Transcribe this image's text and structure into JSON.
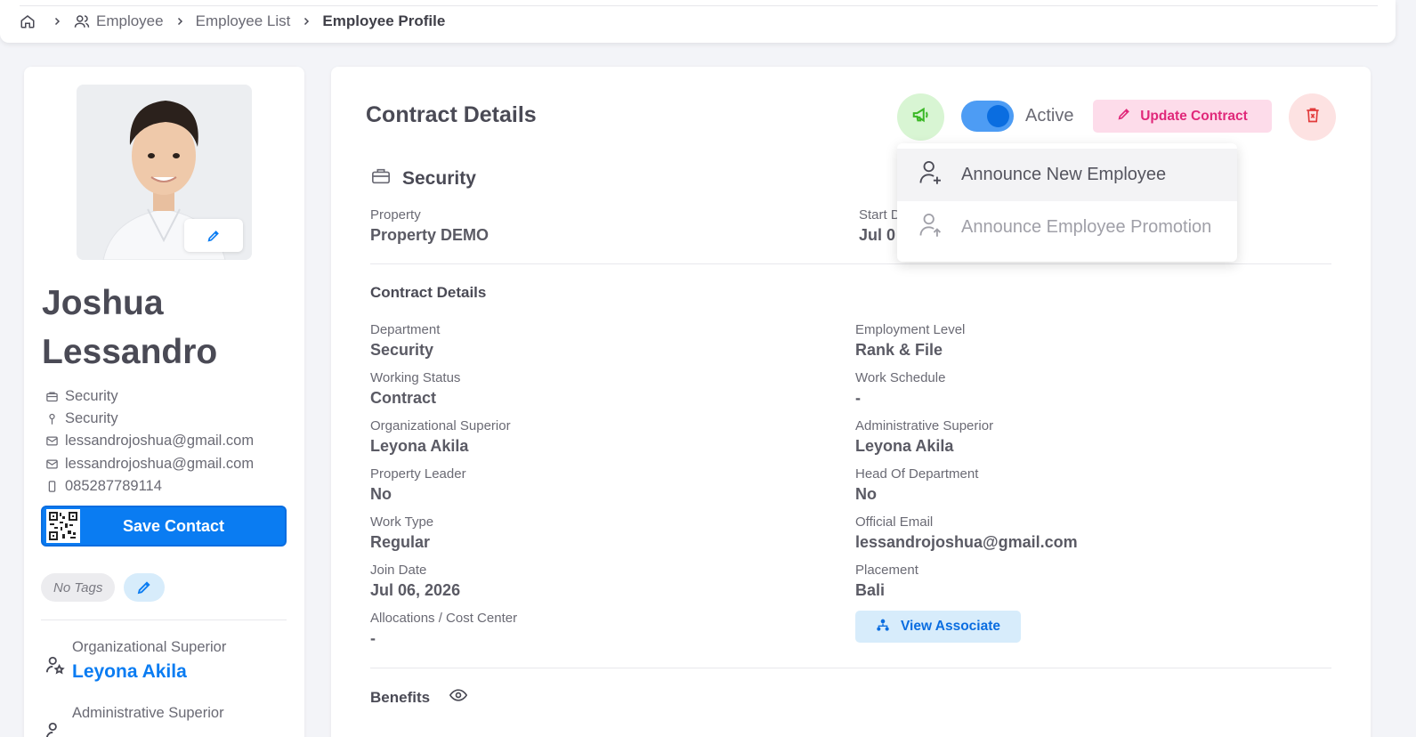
{
  "breadcrumb": {
    "items": [
      "Employee",
      "Employee List"
    ],
    "current": "Employee Profile"
  },
  "profile": {
    "first_name": "Joshua",
    "last_name": "Lessandro",
    "info": [
      {
        "icon": "briefcase-icon",
        "text": "Security"
      },
      {
        "icon": "pin-icon",
        "text": "Security"
      },
      {
        "icon": "mail-check-icon",
        "text": "lessandrojoshua@gmail.com"
      },
      {
        "icon": "mail-icon",
        "text": "lessandrojoshua@gmail.com"
      },
      {
        "icon": "phone-icon",
        "text": "085287789114"
      }
    ],
    "save_contact": "Save Contact",
    "tags_label": "No Tags",
    "org_superior_label": "Organizational Superior",
    "org_superior_name": "Leyona Akila",
    "admin_superior_label": "Administrative Superior"
  },
  "contract": {
    "title": "Contract Details",
    "status_label": "Active",
    "status_on": true,
    "update_button": "Update Contract",
    "section_title": "Security",
    "property_label": "Property",
    "property_value": "Property DEMO",
    "start_label": "Start D",
    "start_value": "Jul 0",
    "details_title": "Contract Details",
    "fields_left": [
      {
        "label": "Department",
        "value": "Security"
      },
      {
        "label": "Working Status",
        "value": "Contract"
      },
      {
        "label": "Organizational Superior",
        "value": "Leyona Akila"
      },
      {
        "label": "Property Leader",
        "value": "No"
      },
      {
        "label": "Work Type",
        "value": "Regular"
      },
      {
        "label": "Join Date",
        "value": "Jul 06, 2026"
      },
      {
        "label": "Allocations / Cost Center",
        "value": "-"
      }
    ],
    "fields_right": [
      {
        "label": "Employment Level",
        "value": "Rank & File"
      },
      {
        "label": "Work Schedule",
        "value": "-"
      },
      {
        "label": "Administrative Superior",
        "value": "Leyona Akila"
      },
      {
        "label": "Head Of Department",
        "value": "No"
      },
      {
        "label": "Official Email",
        "value": "lessandrojoshua@gmail.com"
      },
      {
        "label": "Placement",
        "value": "Bali"
      }
    ],
    "view_associate": "View Associate",
    "benefits_title": "Benefits"
  },
  "announce_menu": {
    "items": [
      {
        "label": "Announce New Employee",
        "icon": "user-plus-icon"
      },
      {
        "label": "Announce Employee Promotion",
        "icon": "user-up-icon"
      }
    ]
  },
  "colors": {
    "primary": "#0a7cf2",
    "pink": "#e0287a",
    "green": "#3ab825",
    "red": "#e23b3b"
  }
}
